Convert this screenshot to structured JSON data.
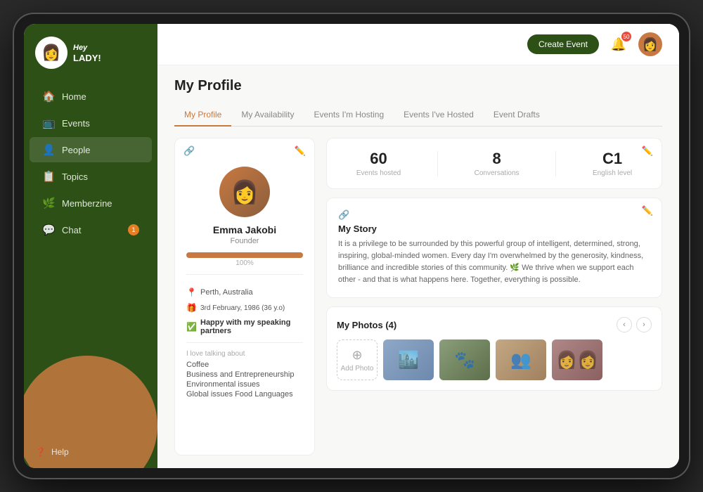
{
  "app": {
    "name": "Hey Lady!",
    "logo_emoji": "👩"
  },
  "header": {
    "create_event_label": "Create Event",
    "notif_count": "50"
  },
  "sidebar": {
    "nav_items": [
      {
        "id": "home",
        "label": "Home",
        "icon": "🏠",
        "badge": null
      },
      {
        "id": "events",
        "label": "Events",
        "icon": "📺",
        "badge": null
      },
      {
        "id": "people",
        "label": "People",
        "icon": "👤",
        "badge": null
      },
      {
        "id": "topics",
        "label": "Topics",
        "icon": "📋",
        "badge": null
      },
      {
        "id": "memberzine",
        "label": "Memberzine",
        "icon": "🌿",
        "badge": null
      },
      {
        "id": "chat",
        "label": "Chat",
        "icon": "💬",
        "badge": "1"
      }
    ],
    "help_label": "Help"
  },
  "page": {
    "title": "My Profile",
    "tabs": [
      {
        "id": "my-profile",
        "label": "My Profile",
        "active": true
      },
      {
        "id": "my-availability",
        "label": "My Availability",
        "active": false
      },
      {
        "id": "events-hosting",
        "label": "Events I'm Hosting",
        "active": false
      },
      {
        "id": "events-hosted",
        "label": "Events I've Hosted",
        "active": false
      },
      {
        "id": "event-drafts",
        "label": "Event Drafts",
        "active": false
      }
    ]
  },
  "profile": {
    "name": "Emma Jakobi",
    "title": "Founder",
    "progress_percent": "100%",
    "progress_value": 100,
    "location": "Perth, Australia",
    "birthday": "3rd February, 1986 (36 y.o)",
    "status": "Happy with my speaking partners",
    "love_talking_label": "I love talking about",
    "interests": [
      "Coffee",
      "Business and Entrepreneurship",
      "Environmental issues",
      "Global issues  Food  Languages"
    ]
  },
  "stats": {
    "events_hosted": {
      "value": "60",
      "label": "Events hosted"
    },
    "conversations": {
      "value": "8",
      "label": "Conversations"
    },
    "english_level": {
      "value": "C1",
      "label": "English level"
    }
  },
  "story": {
    "title": "My Story",
    "text": "It is a privilege to be surrounded by this powerful group of intelligent, determined, strong, inspiring, global-minded women. Every day I'm overwhelmed by the generosity, kindness, brilliance and incredible stories of this community. 🌿 We thrive when we support each other - and that is what happens here. Together, everything is possible."
  },
  "photos": {
    "title": "My Photos (4)",
    "add_label": "Add Photo",
    "count": 4
  }
}
